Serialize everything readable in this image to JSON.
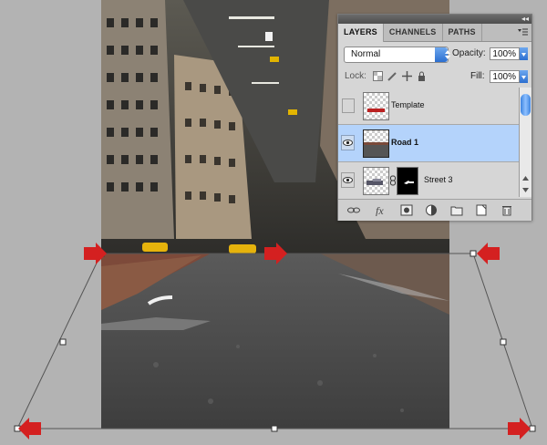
{
  "panel": {
    "tabs": [
      {
        "label": "LAYERS"
      },
      {
        "label": "CHANNELS"
      },
      {
        "label": "PATHS"
      }
    ],
    "collapse_glyph": "◂◂",
    "blend_mode": "Normal",
    "opacity_label": "Opacity:",
    "opacity_value": "100%",
    "lock_label": "Lock:",
    "fill_label": "Fill:",
    "fill_value": "100%",
    "layers": [
      {
        "name": "Template",
        "visible": false,
        "selected": false
      },
      {
        "name": "Road 1",
        "visible": true,
        "selected": true
      },
      {
        "name": "Street 3",
        "visible": true,
        "selected": false,
        "has_mask": true
      }
    ],
    "footer_icons": [
      "link-layers-icon",
      "fx-icon",
      "add-mask-icon",
      "adjustment-layer-icon",
      "new-group-icon",
      "new-layer-icon",
      "trash-icon"
    ]
  },
  "transform": {
    "arrow_color": "#d42020",
    "handle_count": 6
  },
  "colors": {
    "canvas_bg": "#b3b3b3",
    "selected_layer": "#b4d3fb",
    "accent_blue": "#2c6fd0"
  }
}
